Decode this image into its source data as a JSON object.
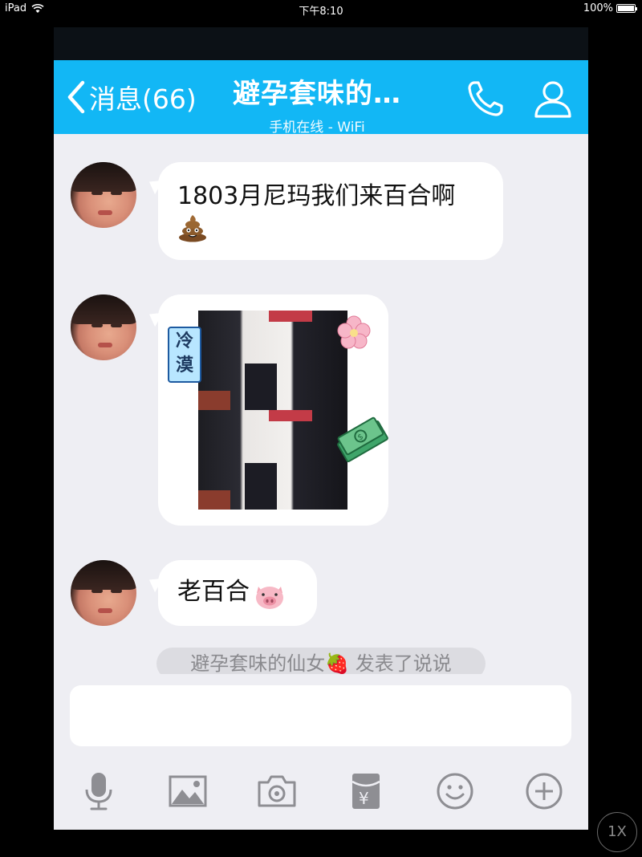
{
  "status_bar": {
    "device": "iPad",
    "time": "下午8:10",
    "battery": "100%"
  },
  "nav": {
    "back_label": "消息(66)",
    "title": "避孕套味的…",
    "subtitle": "手机在线 - WiFi"
  },
  "messages": [
    {
      "text": "1803月尼玛我们来百合啊",
      "emoji": "poo-emoji"
    },
    {
      "type": "image",
      "sticker_text": "冷漠",
      "decorations": [
        "flower-sticker",
        "money-sticker"
      ]
    },
    {
      "text": "老百合",
      "emoji": "pig-emoji"
    }
  ],
  "notice": {
    "text": "避孕套味的仙女🍓 发表了说说"
  },
  "input": {
    "placeholder": ""
  },
  "toolbar": [
    "microphone-icon",
    "image-icon",
    "camera-icon",
    "red-packet-icon",
    "emoji-face-icon",
    "plus-icon"
  ],
  "zoom_button": "1X",
  "colors": {
    "nav_bg": "#12b7f5",
    "chat_bg": "#eeeef3",
    "bubble_bg": "#ffffff",
    "icon_gray": "#8e8e93"
  }
}
